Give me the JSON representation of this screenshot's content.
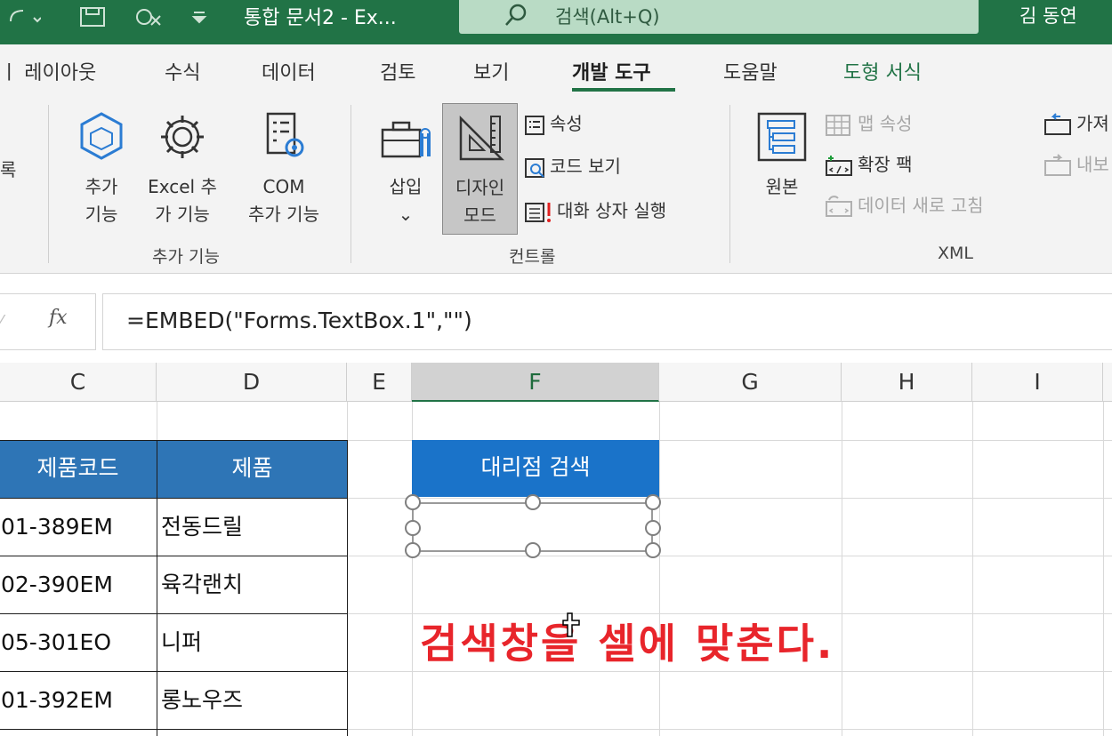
{
  "titlebar": {
    "doc_title": "통합 문서2  -  Ex...",
    "search_placeholder": "검색(Alt+Q)",
    "user": "김 동연"
  },
  "tabs": [
    "ㅣ 레이아웃",
    "수식",
    "데이터",
    "검토",
    "보기",
    "개발 도구",
    "도움말",
    "도형 서식"
  ],
  "active_tab": "개발 도구",
  "ribbon": {
    "cut_label": "록",
    "addins_group": {
      "addins_line1": "추가",
      "addins_line2": "기능",
      "excel_addins_line1": "Excel 추",
      "excel_addins_line2": "가 기능",
      "com_addins_line1": "COM",
      "com_addins_line2": "추가 기능",
      "label": "추가 기능"
    },
    "controls_group": {
      "insert_label": "삽입",
      "insert_caret": "⌄",
      "design_line1": "디자인",
      "design_line2": "모드",
      "properties": "속성",
      "view_code": "코드 보기",
      "run_dialog": "대화 상자 실행",
      "label": "컨트롤"
    },
    "xml_group": {
      "source": "원본",
      "map_properties": "맵 속성",
      "expansion_packs": "확장 팩",
      "refresh_data": "데이터 새로 고침",
      "import_label": "가져",
      "export_label": "내보",
      "label": "XML"
    }
  },
  "formula_bar": {
    "fx_label": "fx",
    "formula": "=EMBED(\"Forms.TextBox.1\",\"\")"
  },
  "grid": {
    "columns": [
      "C",
      "D",
      "E",
      "F",
      "G",
      "H",
      "I"
    ],
    "selected_column": "F",
    "table_headers": [
      "제품코드",
      "제품"
    ],
    "rows": [
      [
        "01-389EM",
        "전동드릴"
      ],
      [
        "02-390EM",
        "육각랜치"
      ],
      [
        "05-301EO",
        "니퍼"
      ],
      [
        "01-392EM",
        "롱노우즈"
      ]
    ],
    "search_header": "대리점 검색",
    "annotation": "검색창을 셀에 맞춘다."
  },
  "colors": {
    "excel_green": "#217346",
    "table_header_blue": "#2e75b6",
    "search_header_blue": "#1a73c9",
    "annotation_red": "#e8252b"
  }
}
